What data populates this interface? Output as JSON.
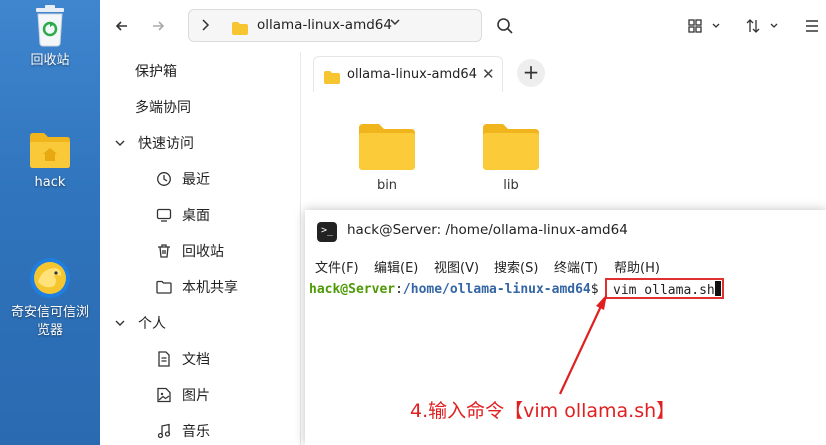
{
  "desktop": {
    "items": [
      {
        "label": "回收站",
        "icon": "trash-icon"
      },
      {
        "label": "hack",
        "icon": "home-folder-icon"
      },
      {
        "label": "奇安信可信浏览器",
        "label_line1": "奇安信可信浏",
        "label_line2": "览器",
        "icon": "browser-icon"
      }
    ]
  },
  "filemanager": {
    "toolbar": {
      "back_icon": "arrow-left-icon",
      "forward_icon": "arrow-right-icon",
      "search_icon": "search-icon",
      "view_icon": "grid-view-icon",
      "sort_icon": "sort-icon",
      "menu_icon": "menu-icon"
    },
    "address": {
      "path": "ollama-linux-amd64"
    },
    "sidebar": {
      "items": [
        {
          "label": "保护箱",
          "icon": ""
        },
        {
          "label": "多端协同",
          "icon": ""
        },
        {
          "label": "快速访问",
          "icon": "chevron-down-icon"
        },
        {
          "label": "最近",
          "icon": "clock-icon"
        },
        {
          "label": "桌面",
          "icon": "monitor-icon"
        },
        {
          "label": "回收站",
          "icon": "trash-icon"
        },
        {
          "label": "本机共享",
          "icon": "folder-icon"
        },
        {
          "label": "个人",
          "icon": "chevron-down-icon"
        },
        {
          "label": "文档",
          "icon": "document-icon"
        },
        {
          "label": "图片",
          "icon": "image-icon"
        },
        {
          "label": "音乐",
          "icon": "music-icon"
        }
      ]
    },
    "tab": {
      "label": "ollama-linux-amd64",
      "close": "✕",
      "add": "+"
    },
    "folders": [
      {
        "name": "bin"
      },
      {
        "name": "lib"
      }
    ],
    "colors": {
      "folder": "#f7c530",
      "folder_dark": "#f0b41c"
    }
  },
  "terminal": {
    "title": "hack@Server: /home/ollama-linux-amd64",
    "menu": [
      "文件(F)",
      "编辑(E)",
      "视图(V)",
      "搜索(S)",
      "终端(T)",
      "帮助(H)"
    ],
    "prompt_user": "hack@Server",
    "prompt_sep": ":",
    "prompt_path": "/home/ollama-linux-amd64",
    "prompt_dollar": "$ ",
    "command": "vim ollama.sh",
    "colors": {
      "user": "#4e9a06",
      "path": "#3465a4"
    }
  },
  "annotation": {
    "text": "4.输入命令【vim ollama.sh】",
    "color": "#e02020"
  }
}
